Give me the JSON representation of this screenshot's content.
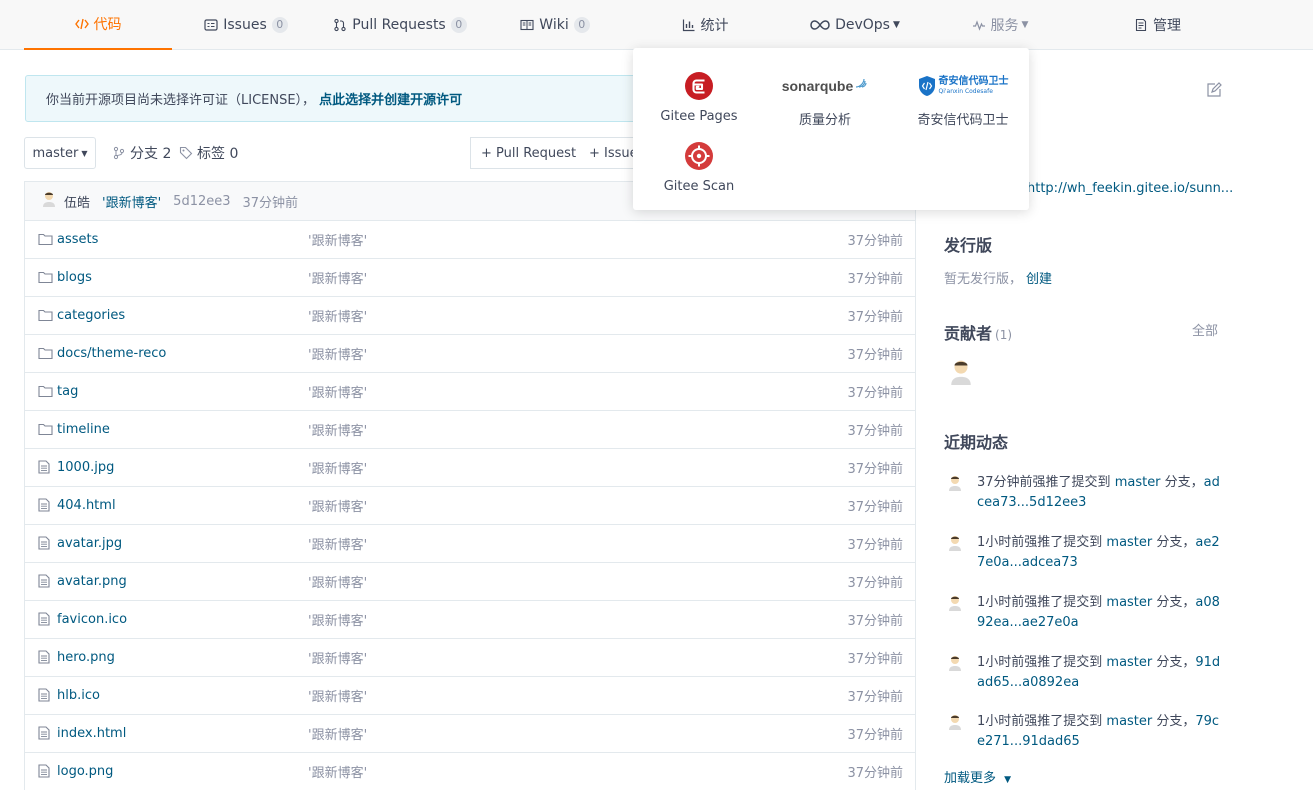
{
  "tabs": [
    {
      "label": "代码",
      "icon": "code-icon",
      "active": true
    },
    {
      "label": "Issues",
      "icon": "issues-icon",
      "count": "0"
    },
    {
      "label": "Pull Requests",
      "icon": "pull-request-icon",
      "count": "0"
    },
    {
      "label": "Wiki",
      "icon": "wiki-icon",
      "count": "0"
    },
    {
      "label": "统计",
      "icon": "stats-icon"
    },
    {
      "label": "DevOps",
      "icon": "devops-icon"
    },
    {
      "label": "服务",
      "icon": "pulse-icon"
    },
    {
      "label": "管理",
      "icon": "manage-icon"
    }
  ],
  "license": {
    "text": "你当前开源项目尚未选择许可证（LICENSE），",
    "link": "点此选择并创建开源许可"
  },
  "branch": {
    "selected": "master",
    "branches_label": "分支 2",
    "tags_label": "标签 0"
  },
  "buttons": {
    "pull_request": "+ Pull Request",
    "issue": "+ Issue"
  },
  "commit": {
    "author": "伍皓",
    "message": "'跟新博客'",
    "hash": "5d12ee3",
    "time": "37分钟前"
  },
  "files": [
    {
      "name": "assets",
      "type": "folder",
      "message": "'跟新博客'",
      "time": "37分钟前"
    },
    {
      "name": "blogs",
      "type": "folder",
      "message": "'跟新博客'",
      "time": "37分钟前"
    },
    {
      "name": "categories",
      "type": "folder",
      "message": "'跟新博客'",
      "time": "37分钟前"
    },
    {
      "name": "docs/theme-reco",
      "type": "folder",
      "message": "'跟新博客'",
      "time": "37分钟前"
    },
    {
      "name": "tag",
      "type": "folder",
      "message": "'跟新博客'",
      "time": "37分钟前"
    },
    {
      "name": "timeline",
      "type": "folder",
      "message": "'跟新博客'",
      "time": "37分钟前"
    },
    {
      "name": "1000.jpg",
      "type": "file",
      "message": "'跟新博客'",
      "time": "37分钟前"
    },
    {
      "name": "404.html",
      "type": "file",
      "message": "'跟新博客'",
      "time": "37分钟前"
    },
    {
      "name": "avatar.jpg",
      "type": "file",
      "message": "'跟新博客'",
      "time": "37分钟前"
    },
    {
      "name": "avatar.png",
      "type": "file",
      "message": "'跟新博客'",
      "time": "37分钟前"
    },
    {
      "name": "favicon.ico",
      "type": "file",
      "message": "'跟新博客'",
      "time": "37分钟前"
    },
    {
      "name": "hero.png",
      "type": "file",
      "message": "'跟新博客'",
      "time": "37分钟前"
    },
    {
      "name": "hlb.ico",
      "type": "file",
      "message": "'跟新博客'",
      "time": "37分钟前"
    },
    {
      "name": "index.html",
      "type": "file",
      "message": "'跟新博客'",
      "time": "37分钟前"
    },
    {
      "name": "logo.png",
      "type": "file",
      "message": "'跟新博客'",
      "time": "37分钟前"
    }
  ],
  "services": [
    {
      "label": "Gitee Pages",
      "icon": "gitee-pages-icon"
    },
    {
      "label": "质量分析",
      "icon": "sonarqube-logo",
      "logo_text": "sonarqube"
    },
    {
      "label": "奇安信代码卫士",
      "icon": "qianxin-codesafe-logo",
      "logo_text": "奇安信代码卫士",
      "logo_sub": "Qi'anxin Codesafe"
    },
    {
      "label": "Gitee Scan",
      "icon": "gitee-scan-icon"
    }
  ],
  "sidebar": {
    "website": "http://wh_feekin.gitee.io/sunn...",
    "release_title": "发行版",
    "release_empty": "暂无发行版，",
    "release_create": "创建",
    "contributors_title": "贡献者",
    "contributors_count": "(1)",
    "contributors_all": "全部",
    "activity_title": "近期动态",
    "activities": [
      {
        "prefix": "37分钟前强推了提交到 ",
        "branch": "master",
        "mid": " 分支，",
        "range": "adcea73...5d12ee3"
      },
      {
        "prefix": "1小时前强推了提交到 ",
        "branch": "master",
        "mid": " 分支，",
        "range": "ae27e0a...adcea73"
      },
      {
        "prefix": "1小时前强推了提交到 ",
        "branch": "master",
        "mid": " 分支，",
        "range": "a0892ea...ae27e0a"
      },
      {
        "prefix": "1小时前强推了提交到 ",
        "branch": "master",
        "mid": " 分支，",
        "range": "91dad65...a0892ea"
      },
      {
        "prefix": "1小时前强推了提交到 ",
        "branch": "master",
        "mid": " 分支，",
        "range": "79ce271...91dad65"
      }
    ],
    "load_more": "加载更多"
  },
  "colors": {
    "accent": "#fe7300",
    "link": "#005980",
    "muted": "#8c92a4",
    "gitee_red": "#c71d23"
  }
}
